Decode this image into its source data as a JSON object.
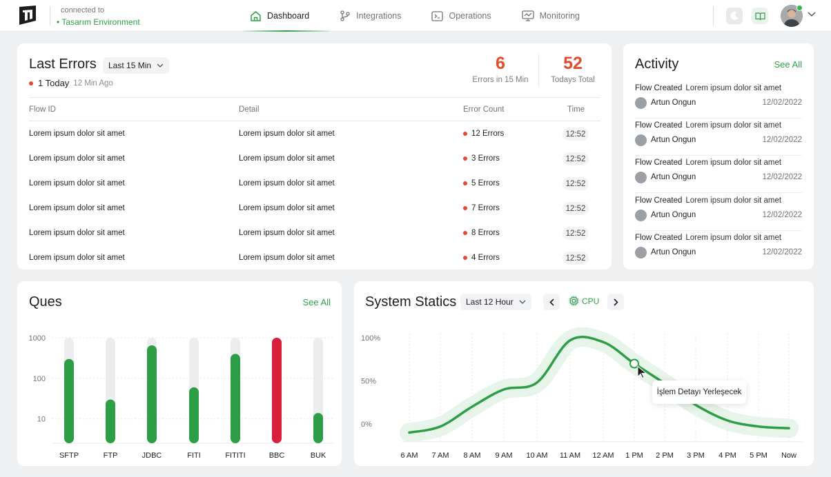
{
  "header": {
    "connected_label": "connected to",
    "environment": "• Tasarım Environment",
    "nav": [
      {
        "label": "Dashboard",
        "icon": "home-icon",
        "active": true
      },
      {
        "label": "Integrations",
        "icon": "git-branch-icon",
        "active": false
      },
      {
        "label": "Operations",
        "icon": "terminal-icon",
        "active": false
      },
      {
        "label": "Monitoring",
        "icon": "monitor-icon",
        "active": false
      }
    ],
    "accent_color": "#2e9e46"
  },
  "last_errors": {
    "title": "Last Errors",
    "range": "Last 15 Min",
    "today_count": "1 Today",
    "today_ago": "12 Min Ago",
    "stats": [
      {
        "value": "6",
        "label": "Errors in 15 Min"
      },
      {
        "value": "52",
        "label": "Todays Total"
      }
    ],
    "columns": [
      "Flow ID",
      "Detail",
      "Error Count",
      "Time"
    ],
    "rows": [
      {
        "flow": "Lorem ipsum dolor sit amet",
        "detail": "Lorem ipsum dolor sit amet",
        "errors": "12 Errors",
        "time": "12:52"
      },
      {
        "flow": "Lorem ipsum dolor sit amet",
        "detail": "Lorem ipsum dolor sit amet",
        "errors": "3 Errors",
        "time": "12:52"
      },
      {
        "flow": "Lorem ipsum dolor sit amet",
        "detail": "Lorem ipsum dolor sit amet",
        "errors": "5 Errors",
        "time": "12:52"
      },
      {
        "flow": "Lorem ipsum dolor sit amet",
        "detail": "Lorem ipsum dolor sit amet",
        "errors": "7 Errors",
        "time": "12:52"
      },
      {
        "flow": "Lorem ipsum dolor sit amet",
        "detail": "Lorem ipsum dolor sit amet",
        "errors": "8 Errors",
        "time": "12:52"
      },
      {
        "flow": "Lorem ipsum dolor sit amet",
        "detail": "Lorem ipsum dolor sit amet",
        "errors": "4 Errors",
        "time": "12:52"
      }
    ],
    "error_color": "#e44b2b"
  },
  "activity": {
    "title": "Activity",
    "see_all": "See All",
    "items": [
      {
        "type": "Flow Created",
        "text": "Lorem ipsum dolor sit amet",
        "user": "Artun Ongun",
        "date": "12/02/2022"
      },
      {
        "type": "Flow Created",
        "text": "Lorem ipsum dolor sit amet",
        "user": "Artun Ongun",
        "date": "12/02/2022"
      },
      {
        "type": "Flow Created",
        "text": "Lorem ipsum dolor sit amet",
        "user": "Artun Ongun",
        "date": "12/02/2022"
      },
      {
        "type": "Flow Created",
        "text": "Lorem ipsum dolor sit amet",
        "user": "Artun Ongun",
        "date": "12/02/2022"
      },
      {
        "type": "Flow Created",
        "text": "Lorem ipsum dolor sit amet",
        "user": "Artun Ongun",
        "date": "12/02/2022"
      }
    ]
  },
  "ques": {
    "title": "Ques",
    "see_all": "See All"
  },
  "system": {
    "title": "System Statics",
    "range": "Last 12 Hour",
    "metric": "CPU",
    "tooltip": "İşlem Detayı Yerleşecek"
  },
  "chart_data": [
    {
      "type": "bar",
      "yscale": "log",
      "ylim": [
        10,
        1000
      ],
      "yticks": [
        "1000",
        "100",
        "10"
      ],
      "categories": [
        "SFTP",
        "FTP",
        "JDBC",
        "FITI",
        "FITITI",
        "BBC",
        "BUK"
      ],
      "values": [
        300,
        30,
        650,
        60,
        400,
        1000,
        14
      ],
      "bar_colors": [
        "#2e9e46",
        "#2e9e46",
        "#2e9e46",
        "#2e9e46",
        "#2e9e46",
        "#d81f3c",
        "#2e9e46"
      ],
      "track_color": "#ebecee",
      "grid": true
    },
    {
      "type": "line",
      "ylim": [
        0,
        100
      ],
      "yticks": [
        "100%",
        "50%",
        "0%"
      ],
      "x": [
        "6 AM",
        "7 AM",
        "8 AM",
        "9 AM",
        "10 AM",
        "11 AM",
        "12 AM",
        "1 PM",
        "2 PM",
        "3 PM",
        "4 PM",
        "5 PM",
        "Now"
      ],
      "series": [
        {
          "values": [
            -10,
            -3,
            20,
            40,
            48,
            97,
            95,
            70,
            47,
            22,
            4,
            -3,
            -5
          ],
          "color": "#2e9e46"
        }
      ],
      "grid": "vertical-dashed",
      "highlight_index": 7
    }
  ]
}
